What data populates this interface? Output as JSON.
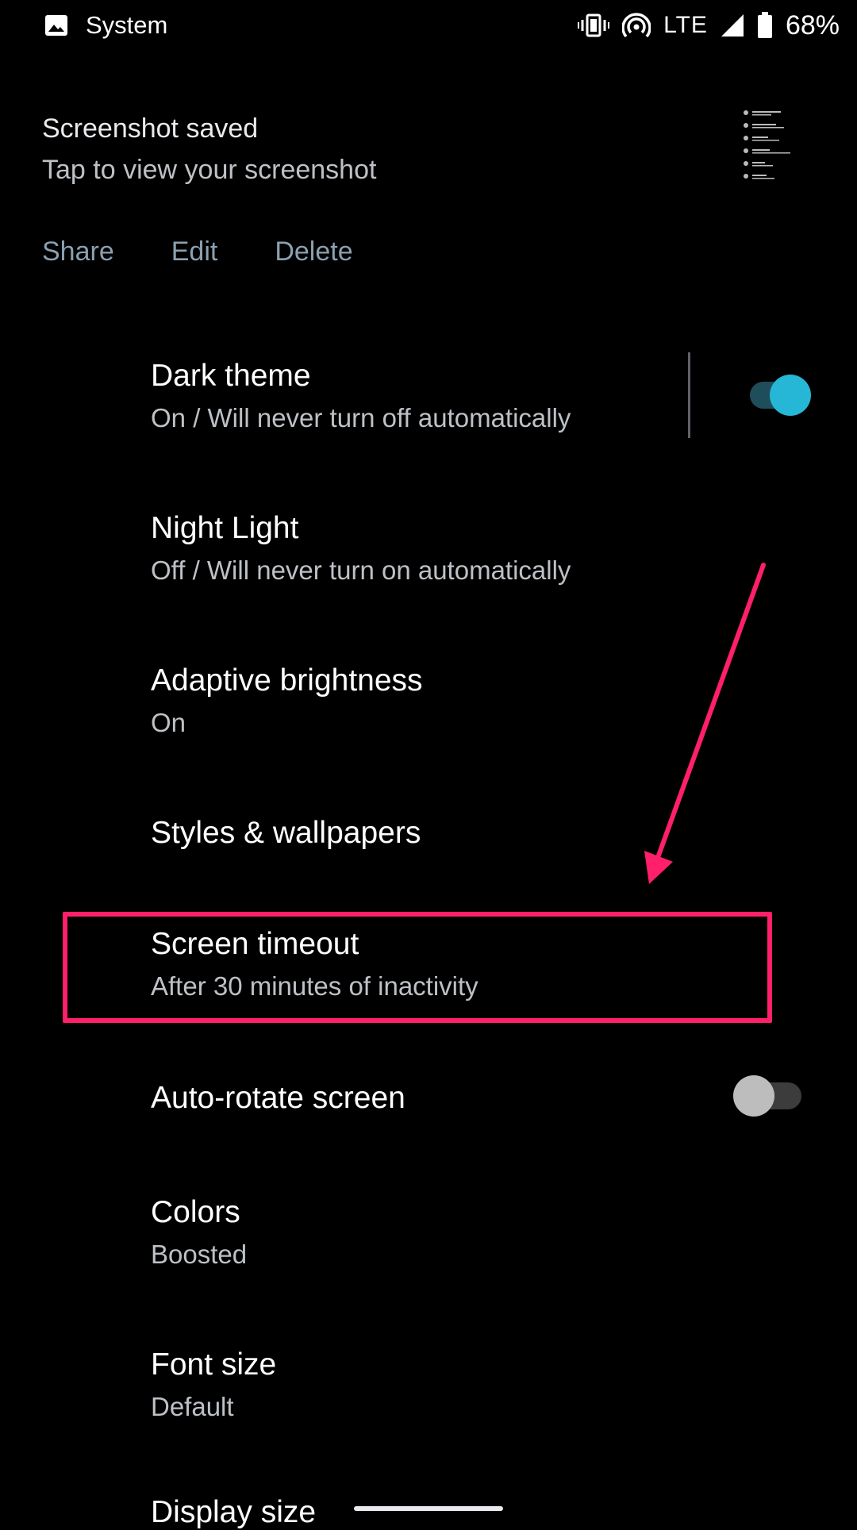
{
  "status_bar": {
    "app_name": "System",
    "network": "LTE",
    "battery_percent": "68%",
    "icons": [
      "image-icon",
      "vibrate-icon",
      "hotspot-icon",
      "signal-icon",
      "battery-icon"
    ]
  },
  "notification": {
    "title": "Screenshot saved",
    "text": "Tap to view your screenshot",
    "actions": [
      "Share",
      "Edit",
      "Delete"
    ]
  },
  "settings": [
    {
      "title": "Dark theme",
      "summary": "On / Will never turn off automatically",
      "toggle": true
    },
    {
      "title": "Night Light",
      "summary": "Off / Will never turn on automatically"
    },
    {
      "title": "Adaptive brightness",
      "summary": "On"
    },
    {
      "title": "Styles & wallpapers",
      "summary": ""
    },
    {
      "title": "Screen timeout",
      "summary": "After 30 minutes of inactivity"
    },
    {
      "title": "Auto-rotate screen",
      "summary": "",
      "toggle": false
    },
    {
      "title": "Colors",
      "summary": "Boosted"
    },
    {
      "title": "Font size",
      "summary": "Default"
    },
    {
      "title": "Display size",
      "summary": ""
    }
  ],
  "colors": {
    "accent": "#26b6d6",
    "accent_track": "#1f4e5a",
    "highlight": "#ff1f6a",
    "action_text": "#8ba0b0"
  }
}
